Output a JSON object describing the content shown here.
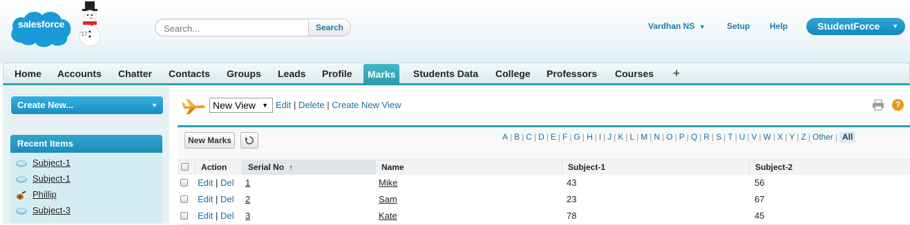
{
  "header": {
    "logo_text": "salesforce",
    "logo_badge": "'17",
    "search_placeholder": "Search...",
    "search_button": "Search",
    "user_name": "Vardhan NS",
    "setup": "Setup",
    "help": "Help",
    "app_name": "StudentForce"
  },
  "tabs": [
    {
      "label": "Home"
    },
    {
      "label": "Accounts"
    },
    {
      "label": "Chatter"
    },
    {
      "label": "Contacts"
    },
    {
      "label": "Groups"
    },
    {
      "label": "Leads"
    },
    {
      "label": "Profile"
    },
    {
      "label": "Marks",
      "active": true
    },
    {
      "label": "Students Data"
    },
    {
      "label": "College"
    },
    {
      "label": "Professors"
    },
    {
      "label": "Courses"
    },
    {
      "label": "+"
    }
  ],
  "sidebar": {
    "create_new": "Create New...",
    "recent_title": "Recent Items",
    "recent_items": [
      {
        "label": "Subject-1",
        "icon": "custom-object-icon"
      },
      {
        "label": "Subject-1",
        "icon": "custom-object-icon"
      },
      {
        "label": "Phillip",
        "icon": "guitar-icon"
      },
      {
        "label": "Subject-3",
        "icon": "custom-object-icon"
      }
    ]
  },
  "view": {
    "selected": "New View",
    "edit": "Edit",
    "delete": "Delete",
    "create": "Create New View",
    "separator": "|"
  },
  "list": {
    "new_button": "New Marks",
    "alphabet": [
      "A",
      "B",
      "C",
      "D",
      "E",
      "F",
      "G",
      "H",
      "I",
      "J",
      "K",
      "L",
      "M",
      "N",
      "O",
      "P",
      "Q",
      "R",
      "S",
      "T",
      "U",
      "V",
      "W",
      "X",
      "Y",
      "Z",
      "Other",
      "All"
    ],
    "selected_letter": "All",
    "columns": {
      "action": "Action",
      "serial": "Serial No",
      "sort_indicator": "↑",
      "name": "Name",
      "subject1": "Subject-1",
      "subject2": "Subject-2"
    },
    "row_actions": {
      "edit": "Edit",
      "del": "Del",
      "separator": "|"
    },
    "rows": [
      {
        "serial": "1",
        "name": "Mike",
        "subject1": "43",
        "subject2": "56"
      },
      {
        "serial": "2",
        "name": "Sam",
        "subject1": "23",
        "subject2": "67"
      },
      {
        "serial": "3",
        "name": "Kate",
        "subject1": "78",
        "subject2": "45"
      }
    ]
  }
}
